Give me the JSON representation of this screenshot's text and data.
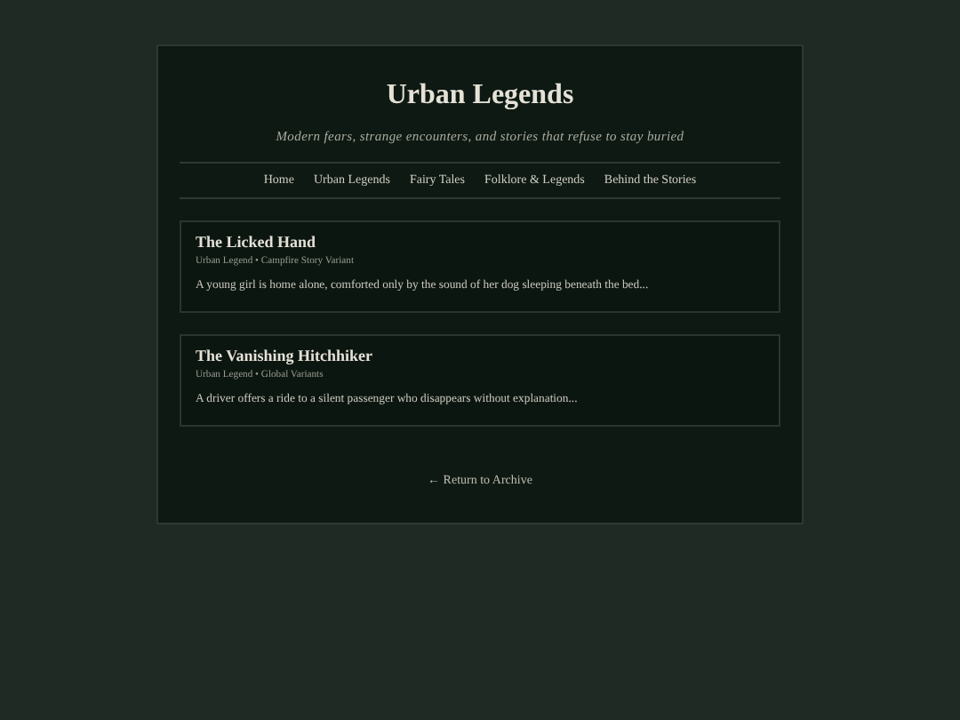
{
  "header": {
    "title": "Urban Legends",
    "subtitle": "Modern fears, strange encounters, and stories that refuse to stay buried"
  },
  "nav": [
    "Home",
    "Urban Legends",
    "Fairy Tales",
    "Folklore & Legends",
    "Behind the Stories"
  ],
  "stories": [
    {
      "title": "The Licked Hand",
      "meta": "Urban Legend • Campfire Story Variant",
      "excerpt": "A young girl is home alone, comforted only by the sound of her dog sleeping beneath the bed..."
    },
    {
      "title": "The Vanishing Hitchhiker",
      "meta": "Urban Legend • Global Variants",
      "excerpt": "A driver offers a ride to a silent passenger who disappears without explanation..."
    }
  ],
  "footer_link": "← Return to Archive"
}
